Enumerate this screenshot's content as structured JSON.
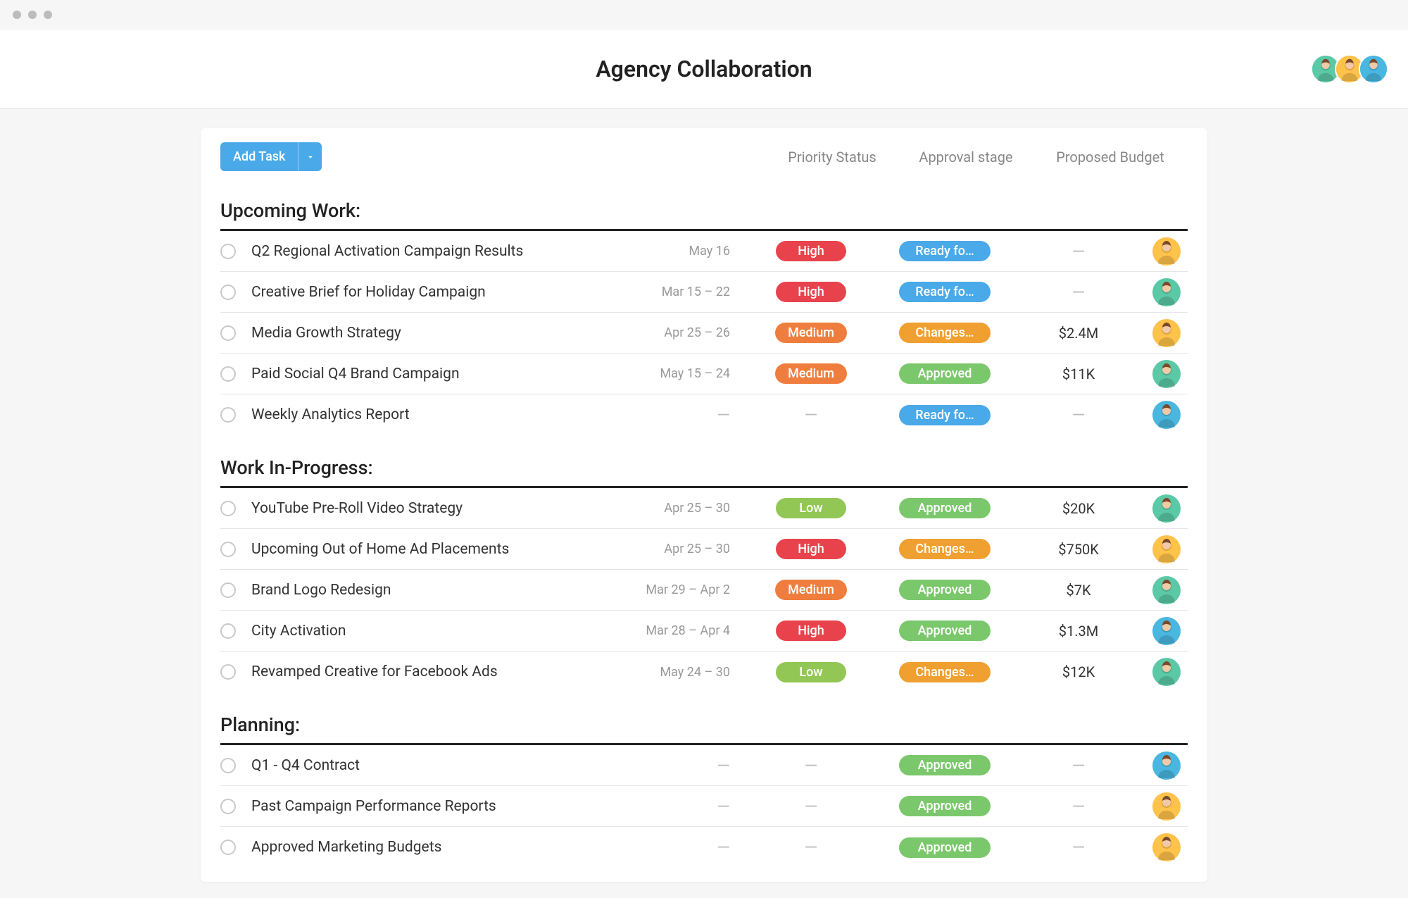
{
  "header": {
    "title": "Agency Collaboration",
    "avatars": [
      "av1",
      "av2",
      "av3"
    ]
  },
  "toolbar": {
    "add_label": "Add Task"
  },
  "columns": {
    "priority": "Priority Status",
    "approval": "Approval stage",
    "budget": "Proposed Budget"
  },
  "avatars_palette": {
    "av1": "#5bc8a6",
    "av2": "#ffc24a",
    "av3": "#4ab7e0",
    "av4": "#ffc24a"
  },
  "sections": [
    {
      "title": "Upcoming Work:",
      "rows": [
        {
          "title": "Q2 Regional Activation Campaign Results",
          "date": "May 16",
          "priority": "High",
          "approval": "Ready fo…",
          "budget": "",
          "assignee": "av2"
        },
        {
          "title": "Creative Brief for Holiday Campaign",
          "date": "Mar 15 – 22",
          "priority": "High",
          "approval": "Ready fo…",
          "budget": "",
          "assignee": "av1"
        },
        {
          "title": "Media Growth Strategy",
          "date": "Apr 25 – 26",
          "priority": "Medium",
          "approval": "Changes…",
          "budget": "$2.4M",
          "assignee": "av2"
        },
        {
          "title": "Paid Social Q4 Brand Campaign",
          "date": "May 15 – 24",
          "priority": "Medium",
          "approval": "Approved",
          "budget": "$11K",
          "assignee": "av1"
        },
        {
          "title": "Weekly Analytics Report",
          "date": "",
          "priority": "",
          "approval": "Ready fo…",
          "budget": "",
          "assignee": "av3"
        }
      ]
    },
    {
      "title": "Work In-Progress:",
      "rows": [
        {
          "title": "YouTube Pre-Roll Video Strategy",
          "date": "Apr 25 – 30",
          "priority": "Low",
          "approval": "Approved",
          "budget": "$20K",
          "assignee": "av1"
        },
        {
          "title": "Upcoming Out of Home Ad Placements",
          "date": "Apr 25 – 30",
          "priority": "High",
          "approval": "Changes…",
          "budget": "$750K",
          "assignee": "av2"
        },
        {
          "title": "Brand Logo Redesign",
          "date": "Mar 29 – Apr 2",
          "priority": "Medium",
          "approval": "Approved",
          "budget": "$7K",
          "assignee": "av1"
        },
        {
          "title": "City Activation",
          "date": "Mar 28 – Apr 4",
          "priority": "High",
          "approval": "Approved",
          "budget": "$1.3M",
          "assignee": "av3"
        },
        {
          "title": "Revamped Creative for Facebook Ads",
          "date": "May 24 – 30",
          "priority": "Low",
          "approval": "Changes…",
          "budget": "$12K",
          "assignee": "av1"
        }
      ]
    },
    {
      "title": "Planning:",
      "rows": [
        {
          "title": "Q1 - Q4 Contract",
          "date": "",
          "priority": "",
          "approval": "Approved",
          "budget": "",
          "assignee": "av3"
        },
        {
          "title": "Past Campaign Performance Reports",
          "date": "",
          "priority": "",
          "approval": "Approved",
          "budget": "",
          "assignee": "av4"
        },
        {
          "title": "Approved Marketing Budgets",
          "date": "",
          "priority": "",
          "approval": "Approved",
          "budget": "",
          "assignee": "av4"
        }
      ]
    }
  ]
}
